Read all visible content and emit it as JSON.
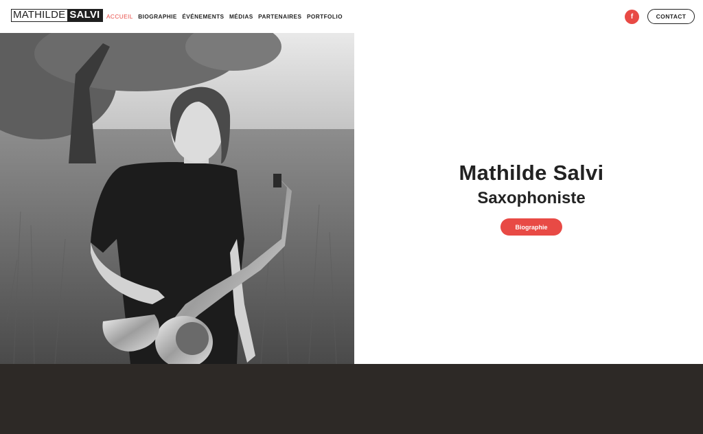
{
  "header": {
    "logo": {
      "first": "MATHILDE",
      "last": "SALVI"
    },
    "nav": [
      {
        "label": "ACCUEIL",
        "active": true
      },
      {
        "label": "BIOGRAPHIE",
        "active": false
      },
      {
        "label": "ÉVÉNEMENTS",
        "active": false
      },
      {
        "label": "MÉDIAS",
        "active": false
      },
      {
        "label": "PARTENAIRES",
        "active": false
      },
      {
        "label": "PORTFOLIO",
        "active": false
      }
    ],
    "facebook_icon_glyph": "f",
    "contact_label": "CONTACT"
  },
  "hero": {
    "name": "Mathilde Salvi",
    "role": "Saxophoniste",
    "button_label": "Biographie",
    "photo_subject": "black-and-white portrait of woman holding a saxophone in a field"
  },
  "colors": {
    "accent": "#e84a45",
    "dark_band": "#2d2926",
    "text": "#222222"
  }
}
